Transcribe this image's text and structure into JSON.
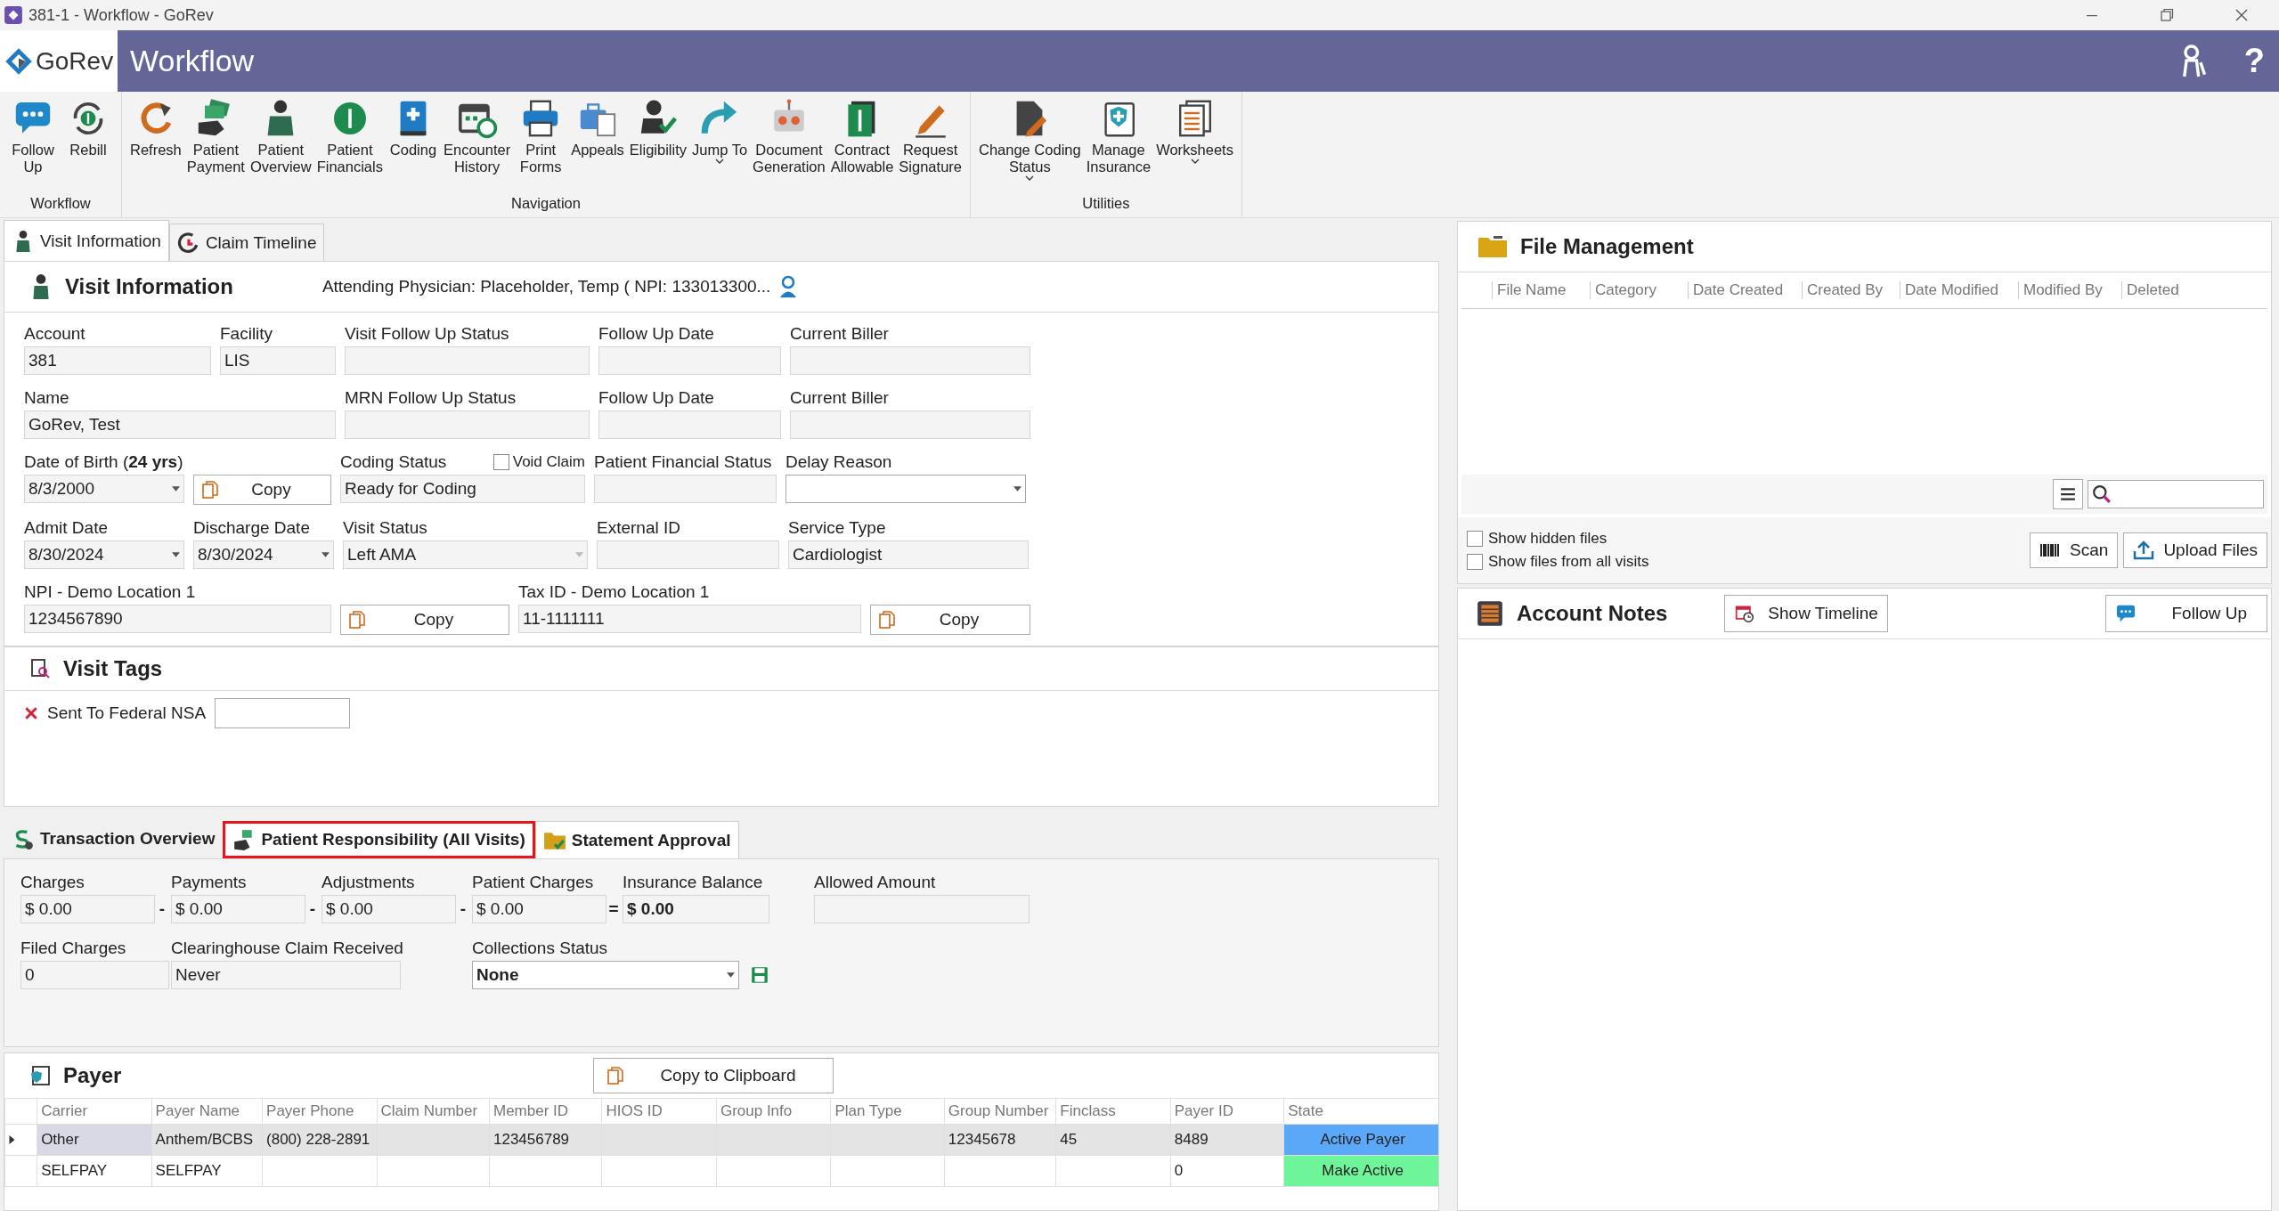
{
  "window": {
    "title": "381-1 - Workflow - GoRev"
  },
  "header": {
    "logo": "GoRev",
    "title": "Workflow",
    "help": "?"
  },
  "ribbon": {
    "groups": [
      {
        "label": "Workflow",
        "items": [
          {
            "label": "Follow\nUp",
            "dropdown": false
          },
          {
            "label": "Rebill",
            "dropdown": false
          }
        ]
      },
      {
        "label": "Navigation",
        "items": [
          {
            "label": "Refresh",
            "dropdown": false
          },
          {
            "label": "Patient\nPayment",
            "dropdown": false
          },
          {
            "label": "Patient\nOverview",
            "dropdown": false
          },
          {
            "label": "Patient\nFinancials",
            "dropdown": false
          },
          {
            "label": "Coding",
            "dropdown": false
          },
          {
            "label": "Encounter\nHistory",
            "dropdown": false
          },
          {
            "label": "Print\nForms",
            "dropdown": false
          },
          {
            "label": "Appeals",
            "dropdown": false
          },
          {
            "label": "Eligibility",
            "dropdown": false
          },
          {
            "label": "Jump To",
            "dropdown": true
          },
          {
            "label": "Document\nGeneration",
            "dropdown": false
          },
          {
            "label": "Contract\nAllowable",
            "dropdown": false
          },
          {
            "label": "Request\nSignature",
            "dropdown": false
          }
        ]
      },
      {
        "label": "Utilities",
        "items": [
          {
            "label": "Change Coding\nStatus",
            "dropdown": true
          },
          {
            "label": "Manage\nInsurance",
            "dropdown": false
          },
          {
            "label": "Worksheets",
            "dropdown": true
          }
        ]
      }
    ]
  },
  "left_tabs": [
    {
      "label": "Visit Information",
      "selected": true
    },
    {
      "label": "Claim Timeline",
      "selected": false
    }
  ],
  "visit_information": {
    "title": "Visit Information",
    "attending": "Attending Physician: Placeholder, Temp ( NPI: 133013300...",
    "fields": [
      {
        "kind": "text",
        "label": "Account",
        "value": "381"
      },
      {
        "kind": "text",
        "label": "Facility",
        "value": "LIS"
      },
      {
        "kind": "text",
        "label": "Visit Follow Up Status"
      },
      {
        "kind": "text",
        "label": "Follow Up Date"
      },
      {
        "kind": "text",
        "label": "Current Biller"
      },
      {
        "kind": "text",
        "label": "Name",
        "value": "GoRev, Test"
      },
      {
        "kind": "text",
        "label": "MRN Follow Up Status"
      },
      {
        "kind": "text",
        "label": "Follow Up Date"
      },
      {
        "kind": "text",
        "label": "Current Biller"
      },
      {
        "kind": "dropdown",
        "label": "Date of Birth (**24 yrs**)",
        "value": "8/3/2000"
      },
      {
        "kind": "button",
        "label": "Copy"
      },
      {
        "kind": "text",
        "label": "Coding Status",
        "value": "Ready for Coding",
        "checkbox": {
          "label": "Void Claim",
          "checked": false
        }
      },
      {
        "kind": "text",
        "label": "Patient Financial Status"
      },
      {
        "kind": "dropdown",
        "label": "Delay Reason",
        "editable": true
      },
      {
        "kind": "dropdown",
        "label": "Admit Date",
        "value": "8/30/2024"
      },
      {
        "kind": "dropdown",
        "label": "Discharge Date",
        "value": "8/30/2024"
      },
      {
        "kind": "dropdown",
        "label": "Visit Status",
        "value": "Left AMA",
        "disabled": true
      },
      {
        "kind": "text",
        "label": "External ID"
      },
      {
        "kind": "text",
        "label": "Service Type",
        "value": "Cardiologist"
      },
      {
        "kind": "text",
        "label": "NPI - Demo Location 1",
        "value": "1234567890"
      },
      {
        "kind": "button",
        "label": "Copy"
      },
      {
        "kind": "text",
        "label": "Tax ID - Demo Location 1",
        "value": "11-1111111"
      },
      {
        "kind": "button",
        "label": "Copy"
      }
    ]
  },
  "visit_tags": {
    "title": "Visit Tags",
    "items": [
      {
        "label": "Sent To Federal NSA"
      }
    ]
  },
  "transaction_tabs": [
    {
      "label": "Transaction Overview",
      "selected": true,
      "highlighted": false
    },
    {
      "label": "Patient Responsibility (All Visits)",
      "selected": false,
      "highlighted": true
    },
    {
      "label": "Statement Approval",
      "selected": false,
      "highlighted": false
    }
  ],
  "transaction_overview": {
    "fields": [
      {
        "kind": "text",
        "label": "Charges",
        "value": "$ 0.00",
        "operator": "-"
      },
      {
        "kind": "text",
        "label": "Payments",
        "value": "$ 0.00",
        "operator": "-"
      },
      {
        "kind": "text",
        "label": "Adjustments",
        "value": "$ 0.00",
        "operator": "-"
      },
      {
        "kind": "text",
        "label": "Patient Charges",
        "value": "$ 0.00",
        "operator": "="
      },
      {
        "kind": "text",
        "label": "Insurance Balance",
        "value": "$ 0.00",
        "bold": true
      },
      {
        "kind": "text",
        "label": "Allowed Amount"
      },
      {
        "kind": "text",
        "label": "Filed Charges",
        "value": "0"
      },
      {
        "kind": "text",
        "label": "Clearinghouse Claim Received",
        "value": "Never"
      },
      {
        "kind": "dropdown",
        "label": "Collections Status",
        "value": "None",
        "bold": true,
        "editable": true
      }
    ]
  },
  "payer": {
    "title": "Payer",
    "copy_button": "Copy to Clipboard",
    "columns": [
      "Carrier",
      "Payer Name",
      "Payer Phone",
      "Claim Number",
      "Member ID",
      "HIOS ID",
      "Group Info",
      "Plan Type",
      "Group Number",
      "Finclass",
      "Payer ID",
      "State"
    ],
    "rows": [
      {
        "selected": true,
        "cells": [
          "Other",
          "Anthem/BCBS",
          "(800) 228-2891",
          null,
          "123456789",
          null,
          null,
          null,
          "12345678",
          "45",
          "8489"
        ],
        "state": "Active Payer",
        "color": "#5aa8f7"
      },
      {
        "selected": false,
        "cells": [
          "SELFPAY",
          "SELFPAY",
          null,
          null,
          null,
          null,
          null,
          null,
          null,
          null,
          "0"
        ],
        "state": "Make Active",
        "color": "#6ef59a"
      }
    ]
  },
  "file_management": {
    "title": "File Management",
    "columns": [
      "File Name",
      "Category",
      "Date Created",
      "Created By",
      "Date Modified",
      "Modified By",
      "Deleted"
    ],
    "checkboxes": [
      {
        "label": "Show hidden files",
        "checked": false
      },
      {
        "label": "Show files from all visits",
        "checked": false
      }
    ],
    "buttons": [
      "Scan",
      "Upload Files"
    ]
  },
  "account_notes": {
    "title": "Account Notes",
    "buttons": [
      "Show Timeline",
      "Follow Up"
    ]
  }
}
